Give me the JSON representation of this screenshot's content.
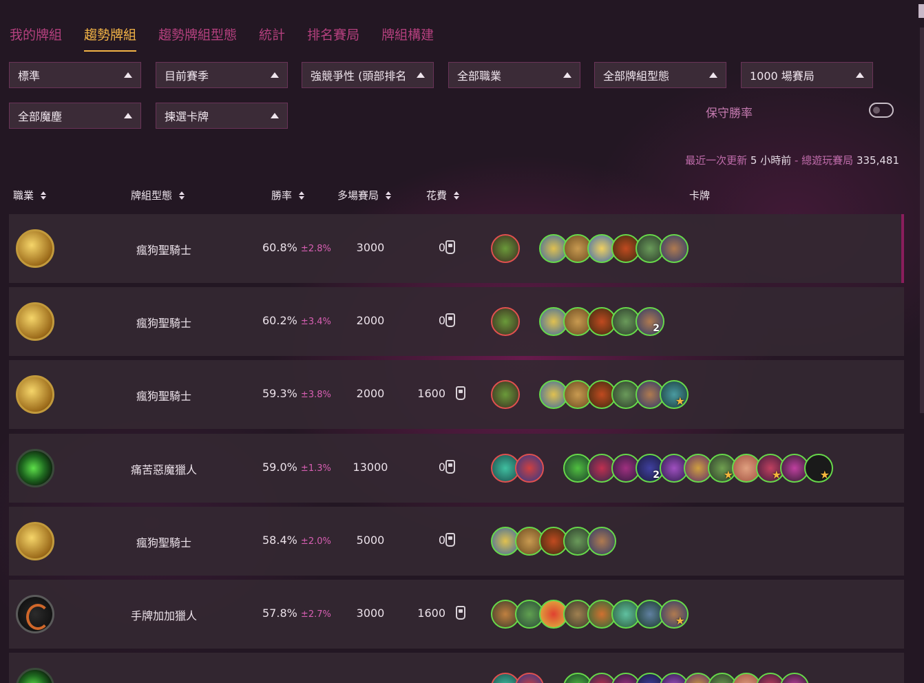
{
  "tabs": [
    "我的牌組",
    "趨勢牌組",
    "趨勢牌組型態",
    "統計",
    "排名賽局",
    "牌組構建"
  ],
  "filters": {
    "format": "標準",
    "season": "目前賽季",
    "rank": "強競爭性 (頭部排名",
    "class": "全部職業",
    "archetype": "全部牌組型態",
    "games": "1000 場賽局",
    "dust": "全部魔塵",
    "cards": "揀選卡牌"
  },
  "conservative_label": "保守勝率",
  "update": {
    "prefix": "最近一次更新",
    "ago": "5 小時前",
    "sep": " - ",
    "total_label": "總遊玩賽局",
    "total": "335,481"
  },
  "columns": {
    "class": "職業",
    "archetype": "牌組型態",
    "winrate": "勝率",
    "games": "多場賽局",
    "cost": "花費",
    "cards": "卡牌"
  },
  "colors": {
    "accent_tab": "#f3b446",
    "tab": "#b4407e",
    "ci": "#d85fb3",
    "legendary_border": "#e0504f",
    "card_border": "#67d94a"
  },
  "rows": [
    {
      "class_icon": "paladin-icon",
      "archetype": "瘋狗聖騎士",
      "winrate": "60.8%",
      "ci": "±2.8%",
      "games": "3000",
      "cost": "0"
    },
    {
      "class_icon": "paladin-icon",
      "archetype": "瘋狗聖騎士",
      "winrate": "60.2%",
      "ci": "±3.4%",
      "games": "2000",
      "cost": "0",
      "count_badge": "2"
    },
    {
      "class_icon": "paladin-icon",
      "archetype": "瘋狗聖騎士",
      "winrate": "59.3%",
      "ci": "±3.8%",
      "games": "2000",
      "cost": "1600"
    },
    {
      "class_icon": "demon-hunter-icon",
      "archetype": "痛苦惡魔獵人",
      "winrate": "59.0%",
      "ci": "±1.3%",
      "games": "13000",
      "cost": "0",
      "count_badge": "2"
    },
    {
      "class_icon": "paladin-icon",
      "archetype": "瘋狗聖騎士",
      "winrate": "58.4%",
      "ci": "±2.0%",
      "games": "5000",
      "cost": "0"
    },
    {
      "class_icon": "hunter-icon",
      "archetype": "手牌加加獵人",
      "winrate": "57.8%",
      "ci": "±2.7%",
      "games": "3000",
      "cost": "1600"
    }
  ]
}
